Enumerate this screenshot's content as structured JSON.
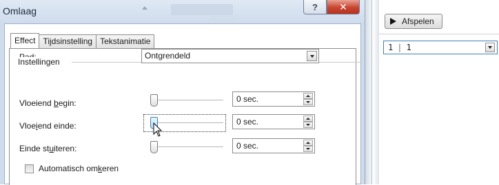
{
  "dialog": {
    "title": "Omlaag",
    "help_glyph": "?",
    "close_glyph": "✕",
    "tabs": [
      {
        "label": "Effect",
        "active": true
      },
      {
        "label": "Tijdsinstelling",
        "active": false
      },
      {
        "label": "Tekstanimatie",
        "active": false
      }
    ],
    "group_label": "Instellingen",
    "path": {
      "label_pre": "",
      "label_u": "P",
      "label_post": "ad:",
      "value": "Ontgrendeld"
    },
    "smooth_start": {
      "label_pre": "Vloeiend ",
      "label_u": "b",
      "label_post": "egin:",
      "value": "0 sec.",
      "level": 0
    },
    "smooth_end": {
      "label_pre": "Vloe",
      "label_u": "i",
      "label_post": "end einde:",
      "value": "0 sec.",
      "level": 0
    },
    "bounce_end": {
      "label_pre": "Einde st",
      "label_u": "u",
      "label_post": "iteren:",
      "value": "0 sec.",
      "level": 0
    },
    "auto_reverse": {
      "label_pre": "Automatisch om",
      "label_u": "k",
      "label_post": "eren",
      "checked": false
    }
  },
  "right_pane": {
    "play_label": "Afspelen",
    "combo_left": "1",
    "combo_right": "1"
  }
}
